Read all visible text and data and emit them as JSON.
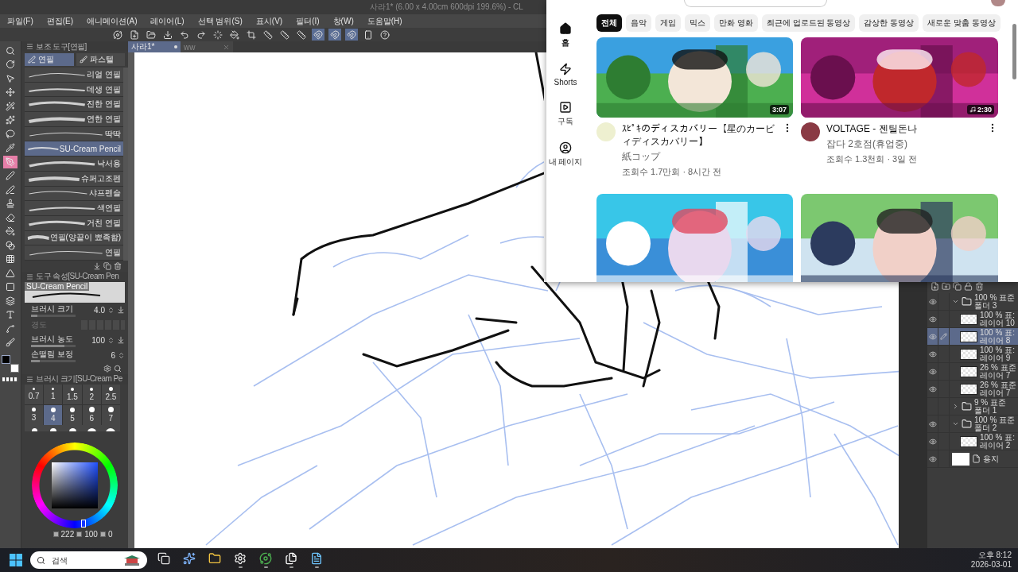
{
  "title": "사라1* (6.00 x 4.00cm 600dpi 199.6%) - CL",
  "menu": [
    "파일(F)",
    "편집(E)",
    "애니메이션(A)",
    "레이어(L)",
    "선택 범위(S)",
    "표시(V)",
    "필터(I)",
    "창(W)",
    "도움말(H)"
  ],
  "toolbar": [
    {
      "kind": "app",
      "on": false
    },
    {
      "kind": "new",
      "on": false
    },
    {
      "kind": "open",
      "on": false
    },
    {
      "kind": "save",
      "on": false
    },
    {
      "kind": "undo",
      "on": false
    },
    {
      "kind": "redo",
      "on": false
    },
    {
      "kind": "deselect",
      "on": false
    },
    {
      "kind": "fill",
      "on": false
    },
    {
      "kind": "crop",
      "on": false
    },
    {
      "kind": "ruler",
      "on": false
    },
    {
      "kind": "ruler",
      "on": false
    },
    {
      "kind": "ruler",
      "on": false
    },
    {
      "kind": "snap",
      "on": true
    },
    {
      "kind": "snap",
      "on": true
    },
    {
      "kind": "snap",
      "on": true
    },
    {
      "kind": "device",
      "on": false
    },
    {
      "kind": "help",
      "on": false
    }
  ],
  "doc_tabs": [
    {
      "label": "사라1*",
      "selected": true
    },
    {
      "label": "ww",
      "selected": false
    }
  ],
  "tools": [
    {
      "kind": "zoom",
      "selected": false
    },
    {
      "kind": "rotate",
      "selected": false
    },
    {
      "kind": "pointer",
      "selected": false
    },
    {
      "kind": "move",
      "selected": false
    },
    {
      "kind": "wand",
      "selected": false
    },
    {
      "kind": "sparkle",
      "selected": false
    },
    {
      "kind": "lasso",
      "selected": false
    },
    {
      "kind": "eyedropper",
      "selected": false
    },
    {
      "kind": "pen",
      "selected": true
    },
    {
      "kind": "nib",
      "selected": false
    },
    {
      "kind": "pencil",
      "selected": false
    },
    {
      "kind": "stamp",
      "selected": false
    },
    {
      "kind": "eraser",
      "selected": false
    },
    {
      "kind": "fill",
      "selected": false
    },
    {
      "kind": "gradient",
      "selected": false
    },
    {
      "kind": "grid",
      "selected": false
    },
    {
      "kind": "triangle",
      "selected": false
    },
    {
      "kind": "rect",
      "selected": false
    },
    {
      "kind": "layers",
      "selected": false
    },
    {
      "kind": "text",
      "selected": false
    },
    {
      "kind": "spline",
      "selected": false
    },
    {
      "kind": "broom",
      "selected": false
    }
  ],
  "subtool": {
    "title": "보조 도구[연필]",
    "tabs": [
      {
        "label": "연필",
        "selected": true
      },
      {
        "label": "파스텔",
        "selected": false
      }
    ],
    "brushes": [
      {
        "name": "리얼 연필",
        "selected": false
      },
      {
        "name": "데생 연필",
        "selected": false
      },
      {
        "name": "진한 연필",
        "selected": false
      },
      {
        "name": "연한 연필",
        "selected": false
      },
      {
        "name": "딱딱",
        "selected": false
      },
      {
        "name": "SU-Cream Pencil",
        "selected": true
      },
      {
        "name": "낙서용",
        "selected": false
      },
      {
        "name": "슈퍼고조펜",
        "selected": false
      },
      {
        "name": "샤프펜슬",
        "selected": false
      },
      {
        "name": "색연필",
        "selected": false
      },
      {
        "name": "거친 연필",
        "selected": false
      },
      {
        "name": "연필(양끝이 뾰족함)",
        "selected": false
      },
      {
        "name": "연필",
        "selected": false
      }
    ]
  },
  "tool_property": {
    "title": "도구 속성[SU-Cream Pen",
    "brush": "SU-Cream Pencil",
    "rows": [
      {
        "label": "브러시 크기",
        "value": "4.0",
        "level": 0.15,
        "disabled": false,
        "pressure": true
      },
      {
        "label": "경도",
        "disabled": true,
        "pressure": false
      },
      {
        "label": "브러시 농도",
        "value": "100",
        "level": 0.75,
        "disabled": false,
        "pressure": true
      },
      {
        "label": "손떨림 보정",
        "value": "6",
        "level": 0.2,
        "disabled": false,
        "pressure": false
      }
    ]
  },
  "brush_size": {
    "title": "브러시 크기[SU-Cream Pe",
    "sizes": [
      {
        "label": "0.7",
        "selected": false
      },
      {
        "label": "1",
        "selected": false
      },
      {
        "label": "1.5",
        "selected": false
      },
      {
        "label": "2",
        "selected": false
      },
      {
        "label": "2.5",
        "selected": false
      },
      {
        "label": "3",
        "selected": false
      },
      {
        "label": "4",
        "selected": true
      },
      {
        "label": "5",
        "selected": false
      },
      {
        "label": "6",
        "selected": false
      },
      {
        "label": "7",
        "selected": false
      }
    ]
  },
  "color": {
    "hue": "222",
    "saturation": "100",
    "value": "0"
  },
  "youtube": {
    "nav": [
      {
        "kind": "home",
        "label": "홈",
        "selected": true
      },
      {
        "kind": "shorts",
        "label": "Shorts",
        "selected": false
      },
      {
        "kind": "subscriptions",
        "label": "구독",
        "selected": false
      },
      {
        "kind": "you",
        "label": "내 페이지",
        "selected": false
      }
    ],
    "chips": [
      {
        "label": "전체",
        "selected": true
      },
      {
        "label": "음악",
        "selected": false
      },
      {
        "label": "게임",
        "selected": false
      },
      {
        "label": "믹스",
        "selected": false
      },
      {
        "label": "만화 영화",
        "selected": false
      },
      {
        "label": "최근에 업로드된 동영상",
        "selected": false
      },
      {
        "label": "감상한 동영상",
        "selected": false
      },
      {
        "label": "새로운 맞춤 동영상",
        "selected": false
      }
    ],
    "videos": [
      {
        "kind": "full",
        "title": "ｽﾋﾟｷのディスカバリー【星のカービィディスカバリー】",
        "channel": "紙コップ",
        "stats": "조회수 1.7만회 · 8시간 전",
        "duration": "3:07",
        "audio": false
      },
      {
        "kind": "full",
        "title": "VOLTAGE - 젠틸돈나",
        "channel": "잡다 2호점(휴업중)",
        "stats": "조회수 1.3천회 · 3일 전",
        "duration": "2:30",
        "audio": true
      },
      {
        "kind": "cut"
      },
      {
        "kind": "cut"
      }
    ]
  },
  "layers": [
    {
      "kind": "folder",
      "blend": "100 % 표준",
      "name": "폴더 3",
      "visible": true,
      "expanded": true,
      "selected": false,
      "children": [
        {
          "kind": "layer",
          "blend": "100 % 표:",
          "name": "레이어 10",
          "visible": true,
          "selected": false
        },
        {
          "kind": "layer",
          "blend": "100 % 표:",
          "name": "레이어 8",
          "visible": true,
          "selected": true
        },
        {
          "kind": "layer",
          "blend": "100 % 표:",
          "name": "레이어 9",
          "visible": true,
          "selected": false
        },
        {
          "kind": "layer",
          "blend": "26 % 표준",
          "name": "레이어 7",
          "visible": true,
          "selected": false
        },
        {
          "kind": "layer",
          "blend": "26 % 표준",
          "name": "레이어 7",
          "visible": true,
          "selected": false
        }
      ]
    },
    {
      "kind": "folder",
      "blend": "9 % 표준",
      "name": "폴더 1",
      "visible": false,
      "expanded": false,
      "selected": false
    },
    {
      "kind": "folder",
      "blend": "100 % 표준",
      "name": "폴더 2",
      "visible": true,
      "expanded": true,
      "selected": false,
      "children": [
        {
          "kind": "layer",
          "blend": "100 % 표:",
          "name": "레이어 2",
          "visible": true,
          "selected": false
        }
      ]
    },
    {
      "kind": "paper",
      "name": "용지",
      "visible": true,
      "selected": false
    }
  ],
  "taskbar": {
    "search_placeholder": "검색",
    "apps": [
      {
        "kind": "taskview",
        "open": false
      },
      {
        "kind": "copilot",
        "open": false
      },
      {
        "kind": "files",
        "open": false
      },
      {
        "kind": "obs",
        "open": true
      },
      {
        "kind": "chrome",
        "open": true
      },
      {
        "kind": "line",
        "open": true
      },
      {
        "kind": "notepad",
        "open": true
      }
    ],
    "time": "오후 8:12",
    "date": "2026-03-01"
  }
}
